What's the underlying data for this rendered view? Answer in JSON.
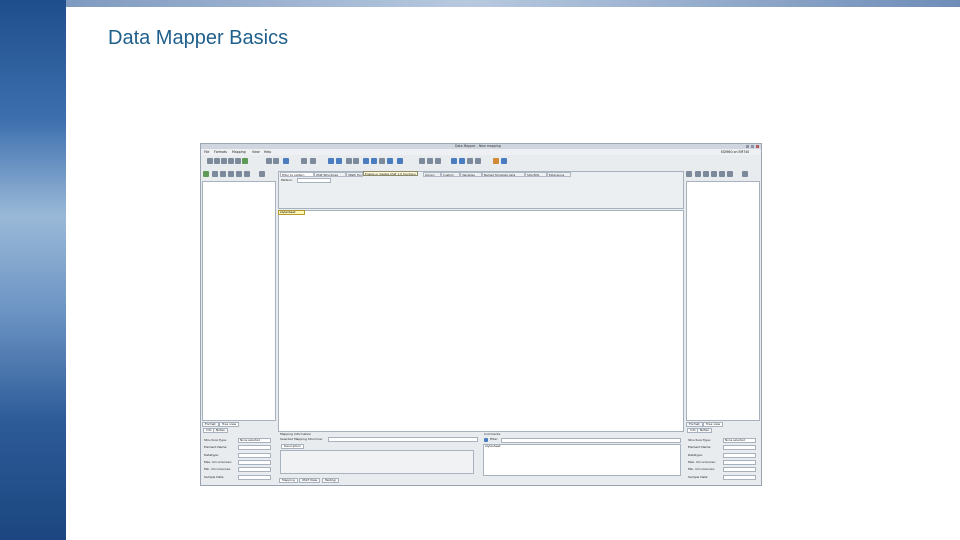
{
  "slide": {
    "title": "Data Mapper Basics"
  },
  "window": {
    "title": "Data Mapper - New mapping",
    "status": "EDI960 on EM740",
    "menu": [
      "File",
      "Formats",
      "Mapping",
      "View",
      "Help"
    ]
  },
  "center": {
    "tabs": [
      "Filter by pattern",
      "XSLT Structures",
      "XPath Functions",
      "Enable or disable XSLT 1.0 functions",
      "Library",
      "Custom",
      "Variables",
      "Named Template Calls",
      "SQL/XML",
      "Extensions"
    ],
    "tooltip": "Enable or disable XSLT 1.0 functions",
    "pattern_label": "Pattern:",
    "pattern_value": "",
    "canvas_tag": "stylesheet"
  },
  "side_panels": {
    "view_tabs": [
      "Format",
      "Tree view"
    ],
    "info_tabs": [
      "Info",
      "Notes"
    ],
    "fields": [
      {
        "label": "Structure Type:",
        "value": "None selected"
      },
      {
        "label": "Element Name:",
        "value": ""
      },
      {
        "label": "Datatype:",
        "value": ""
      },
      {
        "label": "Max. Occurrences:",
        "value": ""
      },
      {
        "label": "Min. Occurrences:",
        "value": ""
      },
      {
        "label": "Sample Data:",
        "value": ""
      }
    ]
  },
  "mapping_info": {
    "header": "Mapping Information",
    "selected_label": "Selected Mapping Structure:",
    "selected_value": "",
    "description_tab": "Description",
    "bottom_tabs": [
      "Mapping",
      "XSLT View",
      "Testing"
    ]
  },
  "comments": {
    "header": "Comments",
    "filter_label": "Filter:",
    "filter_value": "",
    "tree_item": "stylesheet"
  }
}
